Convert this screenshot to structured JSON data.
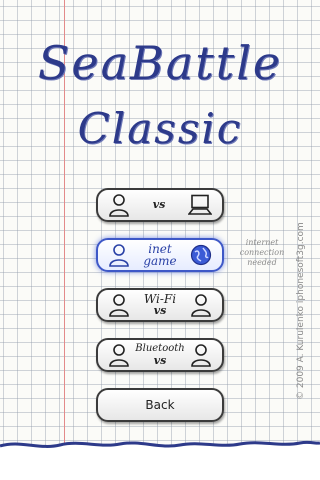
{
  "title": {
    "line1": "SeaBattle",
    "line2": "Classic"
  },
  "menu": {
    "vs_computer": {
      "vs_label": "vs"
    },
    "inet_game": {
      "line1": "inet",
      "line2": "game",
      "note": [
        "internet",
        "connection",
        "needed"
      ]
    },
    "wifi": {
      "label": "Wi-Fi",
      "vs_label": "vs"
    },
    "bluetooth": {
      "label": "Bluetooth",
      "vs_label": "vs"
    },
    "back": {
      "label": "Back"
    }
  },
  "copyright": "© 2009 A. Kurulenko  iphonesoft3g.com",
  "colors": {
    "ink": "#2d3a8a",
    "accent": "#3e58c7",
    "margin_line": "#e38a8a",
    "grid": "#9aa0af"
  }
}
